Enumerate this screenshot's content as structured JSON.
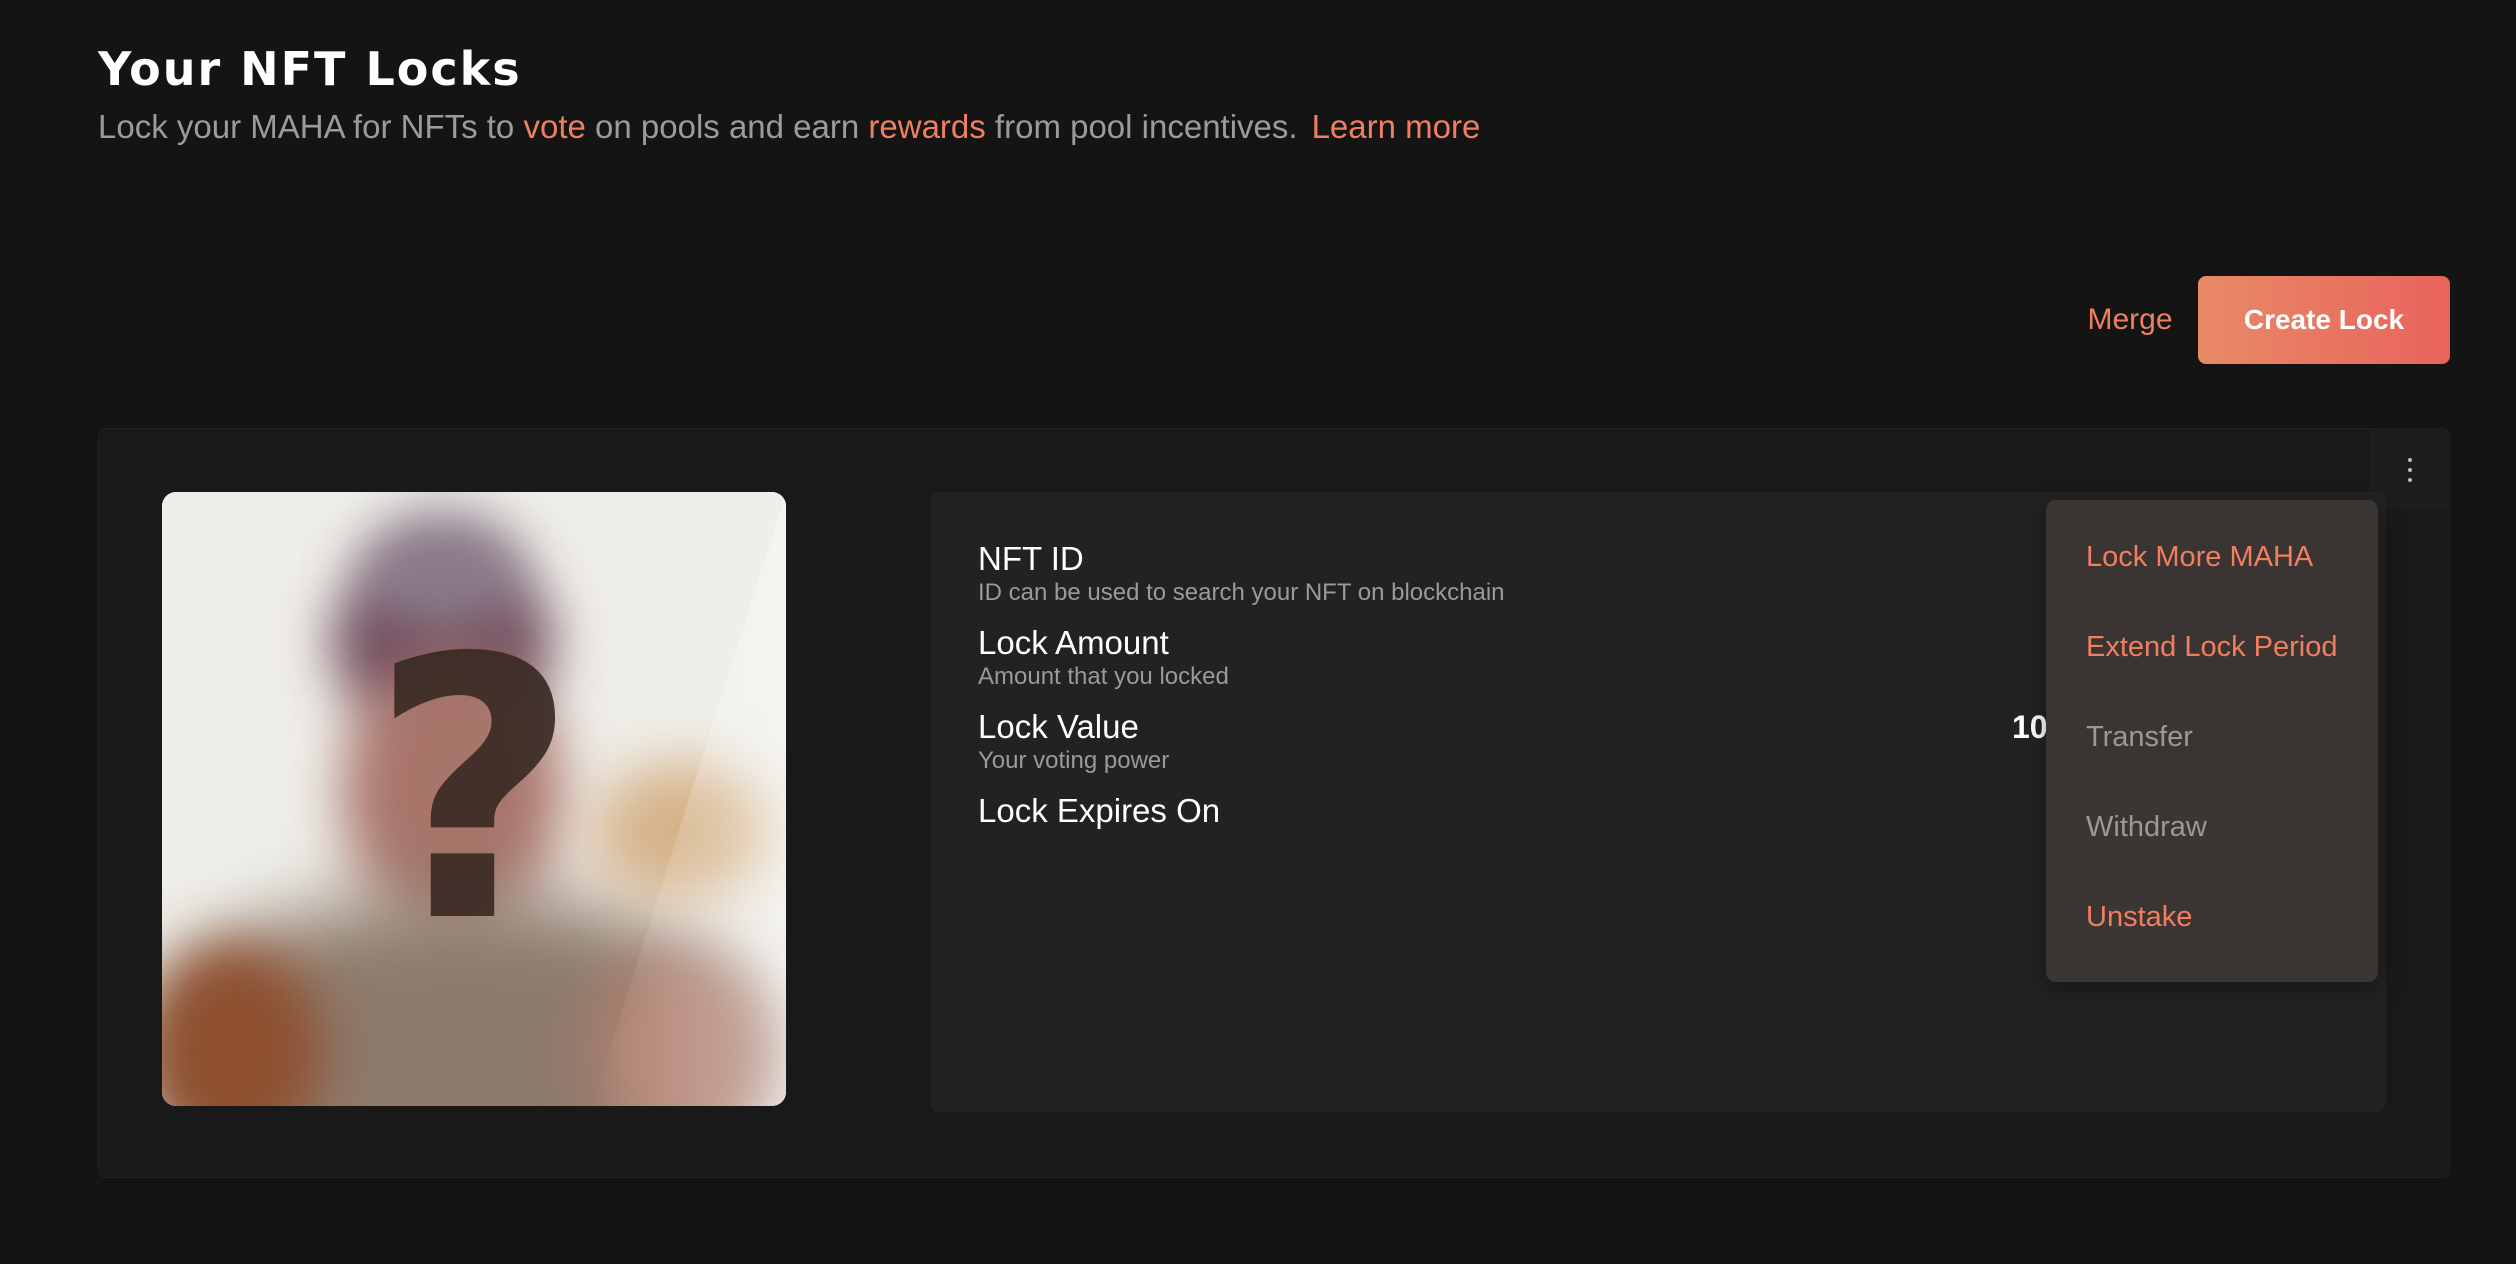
{
  "header": {
    "title": "Your NFT Locks",
    "subtitle_part1": "Lock your MAHA for NFTs to ",
    "subtitle_vote": "vote",
    "subtitle_part2": " on pools and earn ",
    "subtitle_rewards": "rewards",
    "subtitle_part3": " from pool incentives.",
    "learn_more": "Learn more"
  },
  "actions": {
    "merge_label": "Merge",
    "create_lock_label": "Create Lock"
  },
  "lock_card": {
    "image": {
      "placeholder_glyph": "?"
    },
    "details": [
      {
        "label": "NFT ID",
        "help": "ID can be used to search your NFT on blockchain"
      },
      {
        "label": "Lock Amount",
        "help": "Amount that you locked"
      },
      {
        "label": "Lock Value",
        "help": "Your voting power"
      },
      {
        "label": "Lock Expires On",
        "help": ""
      }
    ],
    "lock_value_visible": "10",
    "menu": {
      "items": [
        {
          "label": "Lock More MAHA",
          "enabled": true
        },
        {
          "label": "Extend Lock Period",
          "enabled": true
        },
        {
          "label": "Transfer",
          "enabled": false
        },
        {
          "label": "Withdraw",
          "enabled": false
        },
        {
          "label": "Unstake",
          "enabled": true
        }
      ]
    }
  },
  "colors": {
    "background": "#141414",
    "accent": "#ef7f5f",
    "button_gradient_start": "#e88a66",
    "button_gradient_end": "#e9635c",
    "card_background": "#191919",
    "panel_background": "#222222",
    "menu_background": "#3a3432",
    "muted_text": "#9b9b9b"
  },
  "icons": {
    "kebab": "more-vertical-icon"
  }
}
